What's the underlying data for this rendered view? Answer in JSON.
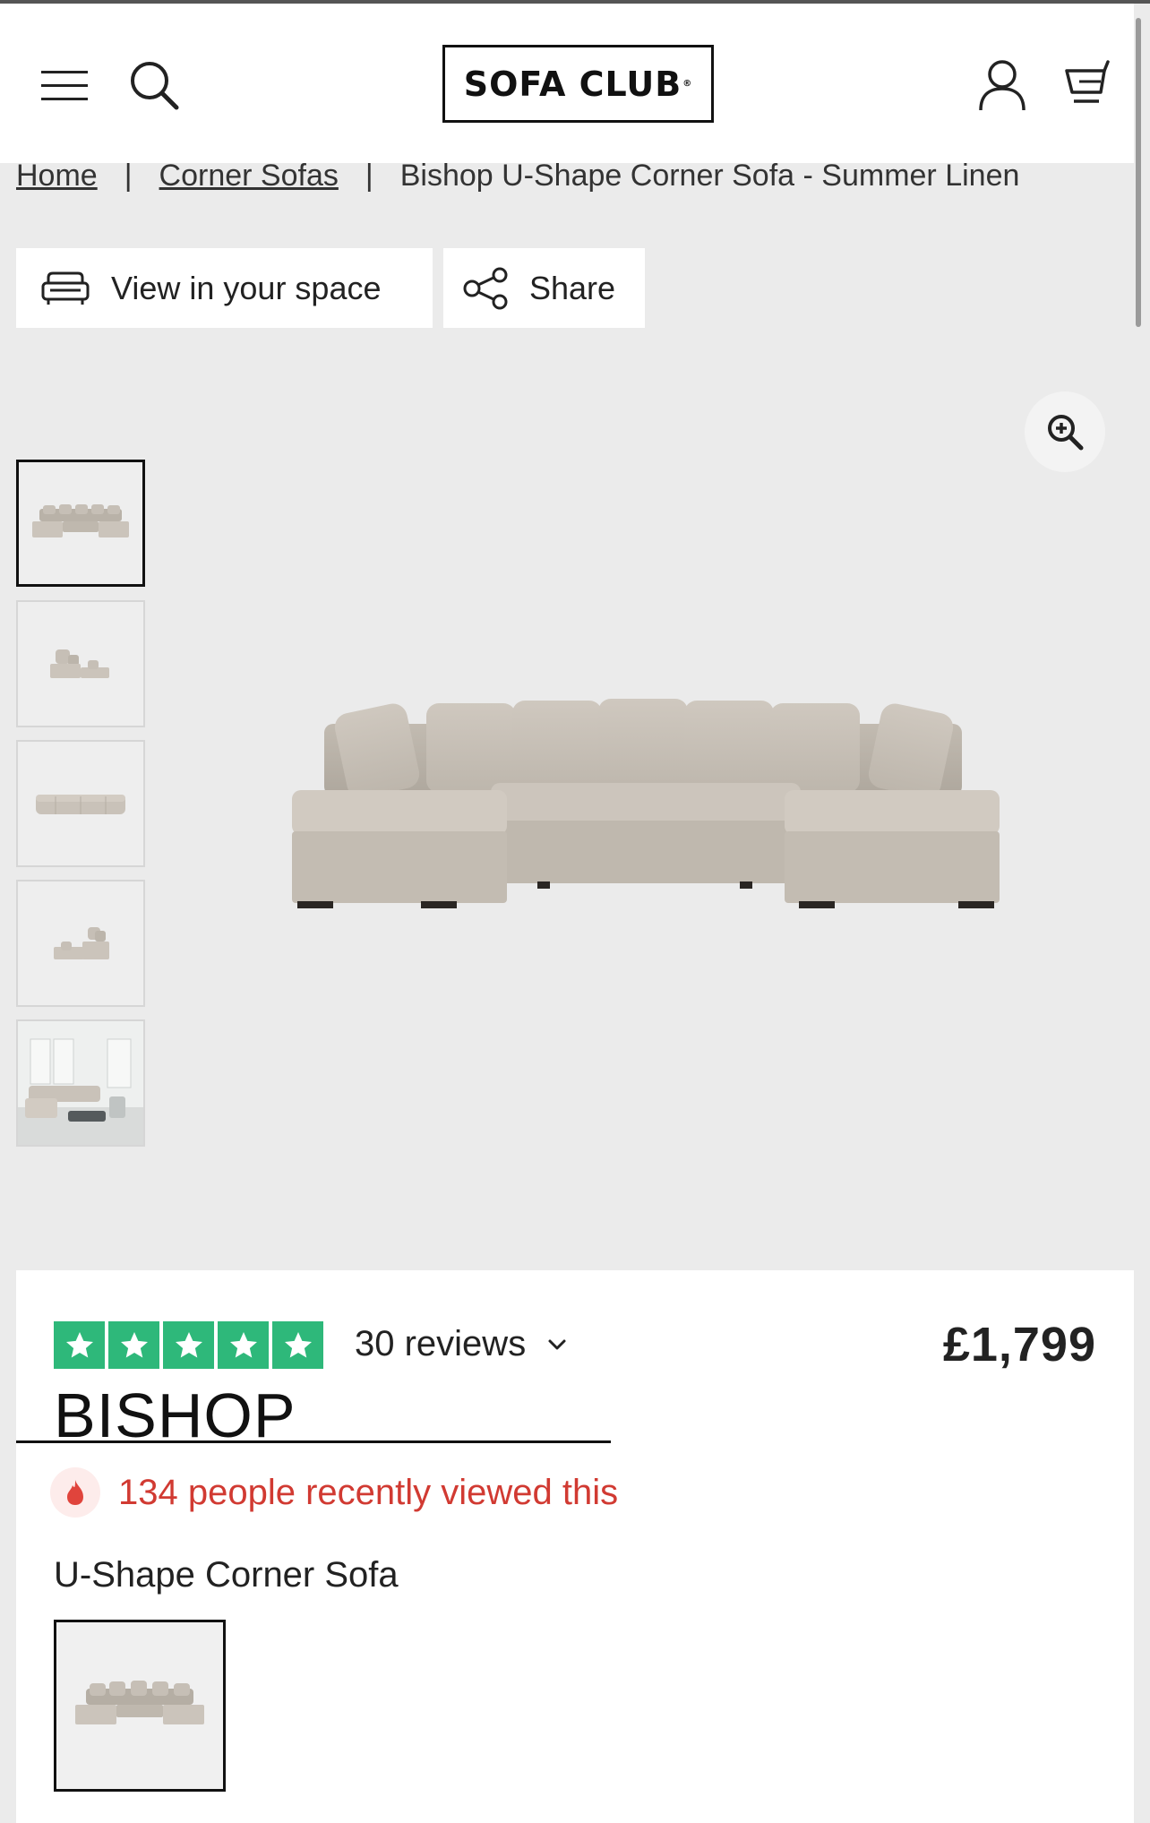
{
  "header": {
    "logo_text": "SOFA CLUB",
    "logo_mark": "®",
    "menu_icon": "menu-icon",
    "search_icon": "search-icon",
    "account_icon": "account-icon",
    "cart_icon": "cart-icon"
  },
  "breadcrumb": {
    "items": [
      "Home",
      "Corner Sofas",
      "Bishop U-Shape Corner Sofa - Summer Linen"
    ],
    "separator": "|"
  },
  "actions": {
    "view_in_space": "View in your space",
    "share": "Share"
  },
  "gallery": {
    "thumbnails": [
      "front view",
      "side view",
      "back view",
      "angled side view",
      "room setting"
    ],
    "selected_index": 0,
    "zoom_icon": "zoom-in-icon"
  },
  "product": {
    "rating_stars": 5,
    "reviews": "30 reviews",
    "price": "£1,799",
    "name": "BISHOP",
    "recently_viewed": "134 people recently viewed this",
    "shape_label": "U-Shape Corner Sofa"
  },
  "colors": {
    "trustpilot_green": "#2eb87a",
    "alert_red": "#d13a32",
    "page_background": "#ebebeb",
    "sofa_fabric": "#c9c2b9"
  }
}
